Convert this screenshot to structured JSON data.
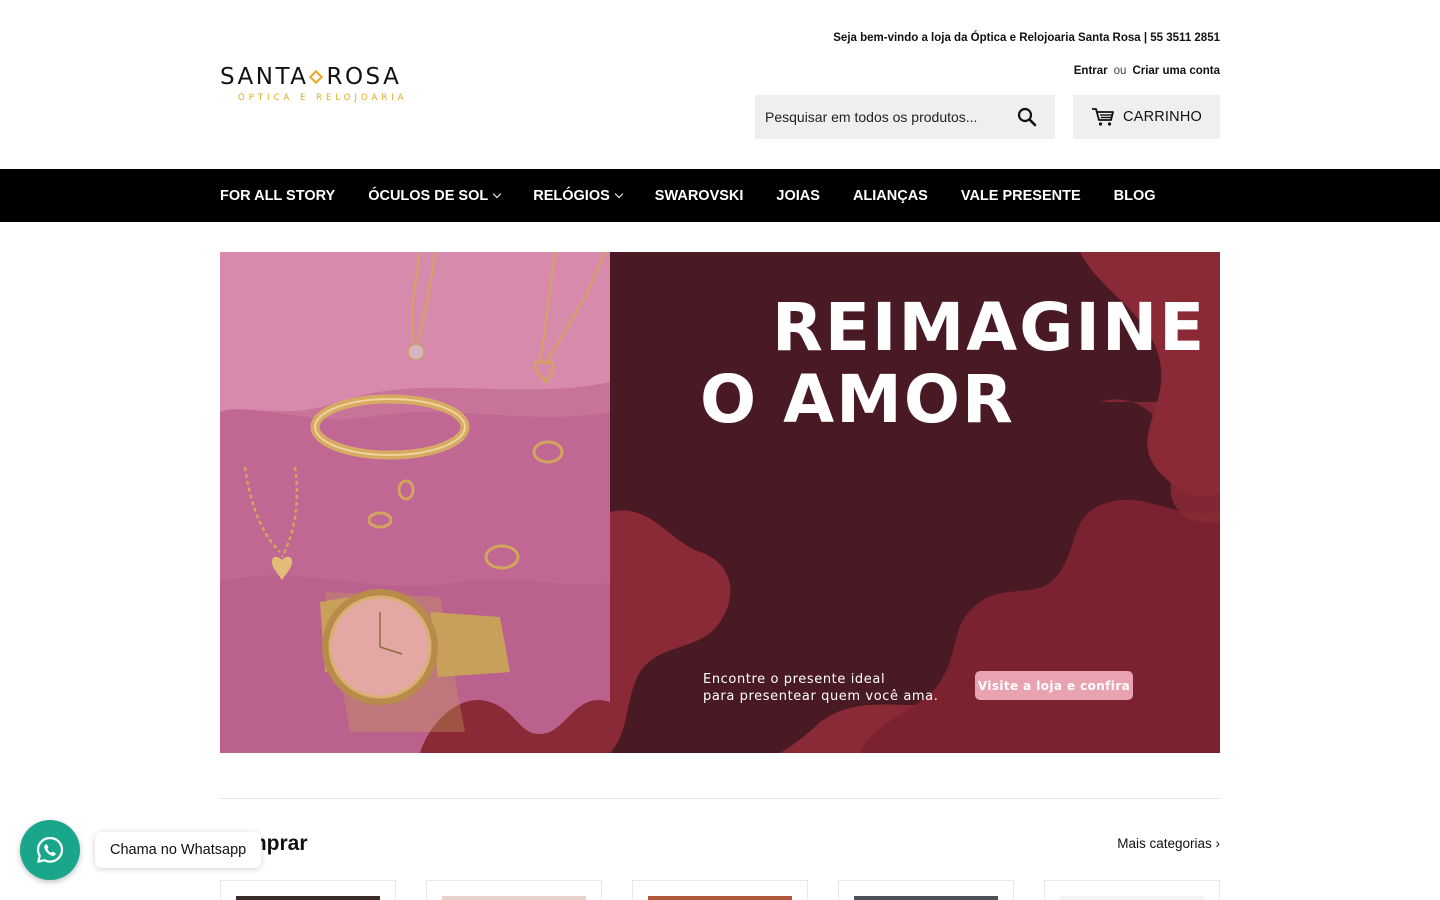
{
  "header": {
    "welcome_text": "Seja bem-vindo a loja da Óptica e Relojoaria Santa Rosa | 55 3511 2851",
    "login_label": "Entrar",
    "or_label": "ou",
    "register_label": "Criar uma conta",
    "logo_main_left": "SANTA",
    "logo_main_right": "ROSA",
    "logo_sub": "ÓPTICA E RELOJOARIA",
    "search_placeholder": "Pesquisar em todos os produtos...",
    "cart_label": "CARRINHO"
  },
  "nav": {
    "items": [
      {
        "label": "FOR ALL STORY"
      },
      {
        "label": "ÓCULOS DE SOL"
      },
      {
        "label": "RELÓGIOS"
      },
      {
        "label": "SWAROVSKI"
      },
      {
        "label": "JOIAS"
      },
      {
        "label": "ALIANÇAS"
      },
      {
        "label": "VALE PRESENTE"
      },
      {
        "label": "BLOG"
      }
    ]
  },
  "hero": {
    "title_line1": "REIMAGINE",
    "title_line2": "O AMOR",
    "subtitle_line1": "Encontre o presente ideal",
    "subtitle_line2": "para presentear quem você ama.",
    "cta_label": "Visite a loja e confira"
  },
  "categories": {
    "title": "Comprar",
    "more_label": "Mais categorias ›"
  },
  "whatsapp": {
    "label": "Chama no Whatsapp"
  },
  "colors": {
    "brand_gold": "#e5a91f",
    "nav_bg": "#000000",
    "hero_dark": "#4a1a24",
    "hero_red": "#8a2a36",
    "hero_pink": "#c8739a",
    "cta_pink": "#e8a2b0",
    "whatsapp_green": "#1aa68a"
  }
}
